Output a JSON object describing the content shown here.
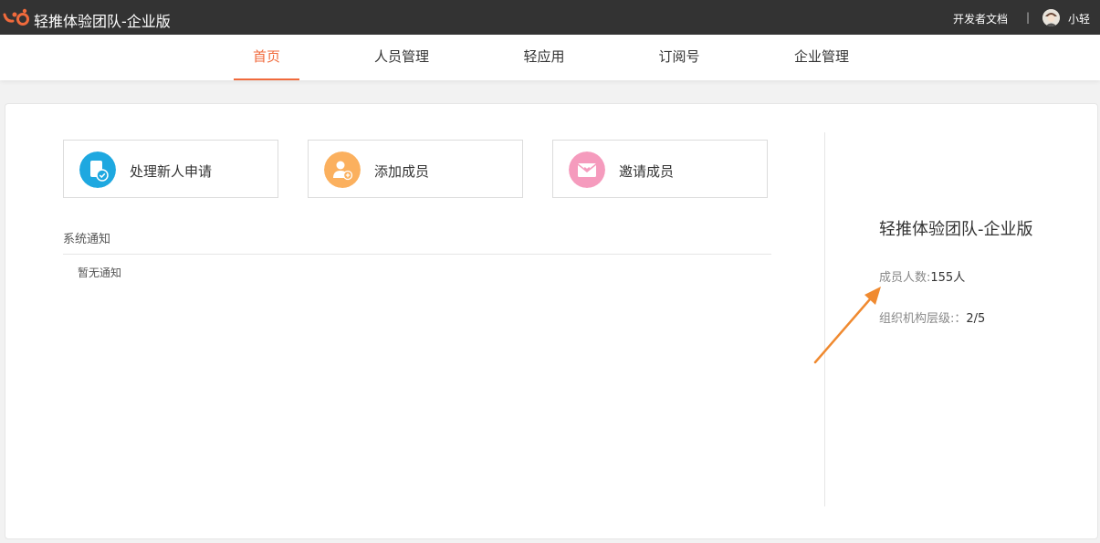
{
  "header": {
    "title": "轻推体验团队-企业版",
    "dev_docs": "开发者文档",
    "separator": "|",
    "user_name": "小轻",
    "logo_icon": "qingtui-logo-icon",
    "brand_color": "#f06a3c"
  },
  "nav": {
    "tabs": [
      {
        "label": "首页",
        "active": true
      },
      {
        "label": "人员管理",
        "active": false
      },
      {
        "label": "轻应用",
        "active": false
      },
      {
        "label": "订阅号",
        "active": false
      },
      {
        "label": "企业管理",
        "active": false
      }
    ]
  },
  "actions": [
    {
      "label": "处理新人申请",
      "icon": "document-check-icon",
      "color": "#1ea8e0"
    },
    {
      "label": "添加成员",
      "icon": "add-user-icon",
      "color": "#fbb05e"
    },
    {
      "label": "邀请成员",
      "icon": "invite-envelope-icon",
      "color": "#f59bbd"
    }
  ],
  "notifications": {
    "title": "系统通知",
    "empty_text": "暂无通知"
  },
  "org": {
    "name": "轻推体验团队-企业版",
    "member_label": "成员人数:",
    "member_value": "155人",
    "levels_label": "组织机构层级:：",
    "levels_value": "2/5"
  }
}
